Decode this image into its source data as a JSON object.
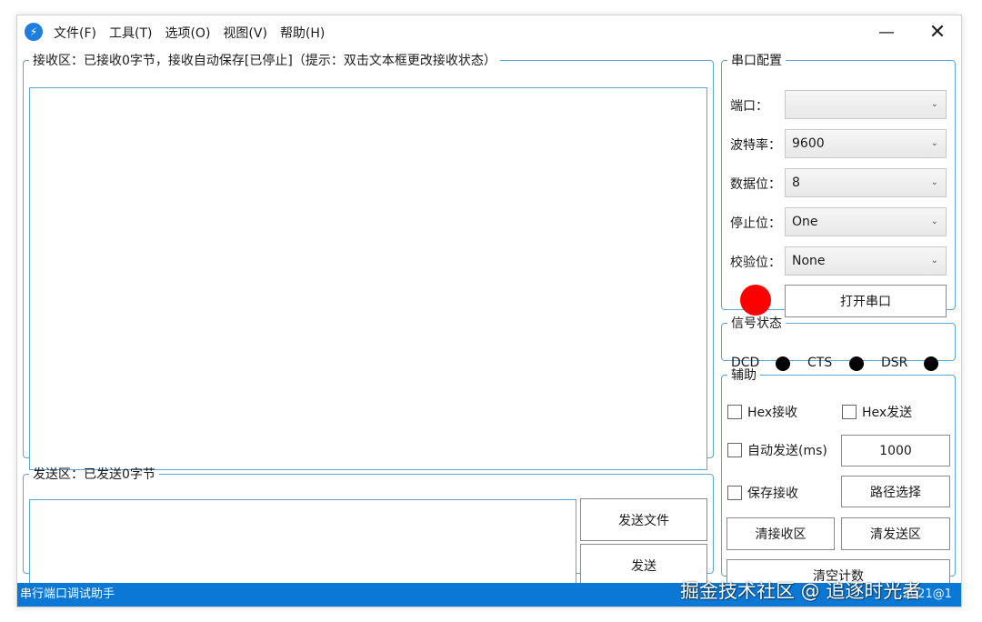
{
  "menu": {
    "file": "文件(F)",
    "tools": "工具(T)",
    "options": "选项(O)",
    "view": "视图(V)",
    "help": "帮助(H)"
  },
  "window_controls": {
    "minimize": "—",
    "close": "✕"
  },
  "receive": {
    "title": "接收区：已接收0字节，接收自动保存[已停止]（提示：双击文本框更改接收状态）",
    "content": ""
  },
  "send": {
    "title": "发送区：已发送0字节",
    "content": "",
    "send_file_label": "发送文件",
    "send_label": "发送"
  },
  "serial_config": {
    "title": "串口配置",
    "port_label": "端口：",
    "port_value": "",
    "baud_label": "波特率：",
    "baud_value": "9600",
    "databits_label": "数据位：",
    "databits_value": "8",
    "stopbits_label": "停止位：",
    "stopbits_value": "One",
    "parity_label": "校验位：",
    "parity_value": "None",
    "open_label": "打开串口",
    "indicator_color": "#ff0000"
  },
  "signal": {
    "title": "信号状态",
    "dcd": "DCD",
    "cts": "CTS",
    "dsr": "DSR"
  },
  "aux": {
    "title": "辅助",
    "hex_recv": "Hex接收",
    "hex_send": "Hex发送",
    "auto_send": "自动发送(ms)",
    "interval": "1000",
    "save_recv": "保存接收",
    "path_select": "路径选择",
    "clear_recv": "清接收区",
    "clear_send": "清发送区",
    "clear_count": "清空计数"
  },
  "status": {
    "app_name": "串行端口调试助手",
    "right_text": "2021@1"
  },
  "watermark": "掘金技术社区 @ 追逐时光者",
  "colors": {
    "accent": "#0a78d4",
    "group_border": "#5aa7d8"
  }
}
